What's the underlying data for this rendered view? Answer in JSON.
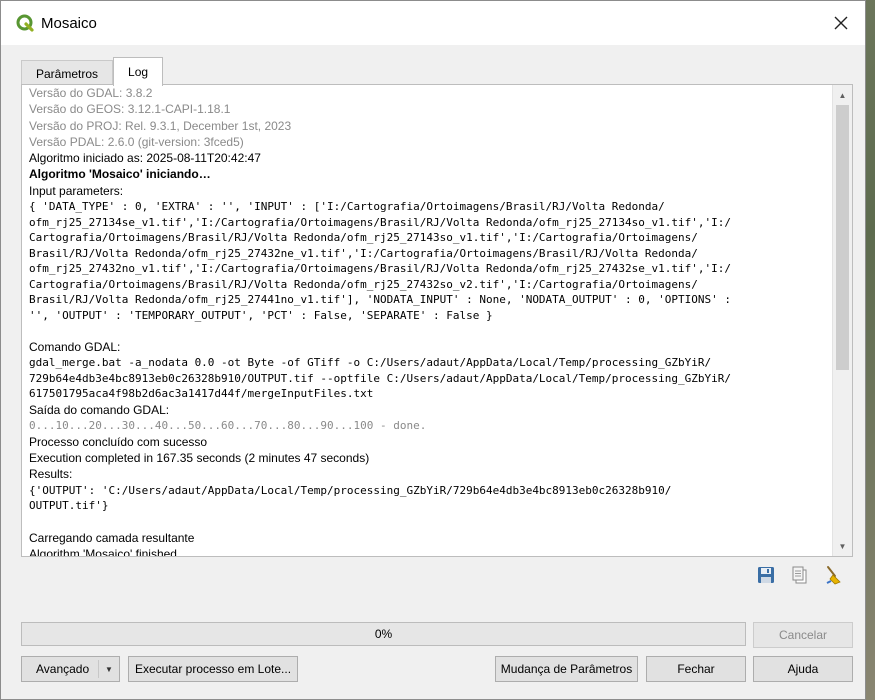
{
  "window": {
    "title": "Mosaico",
    "icon": "qgis-icon",
    "close_icon": "close-icon"
  },
  "tabs": [
    {
      "label": "Parâmetros",
      "active": false
    },
    {
      "label": "Log",
      "active": true
    }
  ],
  "log": {
    "lines": [
      {
        "text": "Versão do GDAL: 3.8.2",
        "style": "gray"
      },
      {
        "text": "Versão do GEOS: 3.12.1-CAPI-1.18.1",
        "style": "gray"
      },
      {
        "text": "Versão do PROJ: Rel. 9.3.1, December 1st, 2023",
        "style": "gray"
      },
      {
        "text": "Versão PDAL: 2.6.0 (git-version: 3fced5)",
        "style": "gray"
      },
      {
        "text": "Algoritmo iniciado as: 2025-08-11T20:42:47",
        "style": "normal"
      },
      {
        "text": "Algoritmo 'Mosaico' iniciando…",
        "style": "bold"
      },
      {
        "text": "Input parameters:",
        "style": "normal"
      },
      {
        "text": "{ 'DATA_TYPE' : 0, 'EXTRA' : '', 'INPUT' : ['I:/Cartografia/Ortoimagens/Brasil/RJ/Volta Redonda/",
        "style": "mono"
      },
      {
        "text": "ofm_rj25_27134se_v1.tif','I:/Cartografia/Ortoimagens/Brasil/RJ/Volta Redonda/ofm_rj25_27134so_v1.tif','I:/",
        "style": "mono"
      },
      {
        "text": "Cartografia/Ortoimagens/Brasil/RJ/Volta Redonda/ofm_rj25_27143so_v1.tif','I:/Cartografia/Ortoimagens/",
        "style": "mono"
      },
      {
        "text": "Brasil/RJ/Volta Redonda/ofm_rj25_27432ne_v1.tif','I:/Cartografia/Ortoimagens/Brasil/RJ/Volta Redonda/",
        "style": "mono"
      },
      {
        "text": "ofm_rj25_27432no_v1.tif','I:/Cartografia/Ortoimagens/Brasil/RJ/Volta Redonda/ofm_rj25_27432se_v1.tif','I:/",
        "style": "mono"
      },
      {
        "text": "Cartografia/Ortoimagens/Brasil/RJ/Volta Redonda/ofm_rj25_27432so_v2.tif','I:/Cartografia/Ortoimagens/",
        "style": "mono"
      },
      {
        "text": "Brasil/RJ/Volta Redonda/ofm_rj25_27441no_v1.tif'], 'NODATA_INPUT' : None, 'NODATA_OUTPUT' : 0, 'OPTIONS' :",
        "style": "mono"
      },
      {
        "text": "'', 'OUTPUT' : 'TEMPORARY_OUTPUT', 'PCT' : False, 'SEPARATE' : False }",
        "style": "mono"
      },
      {
        "text": "",
        "style": "blank"
      },
      {
        "text": "Comando GDAL:",
        "style": "normal"
      },
      {
        "text": "gdal_merge.bat -a_nodata 0.0 -ot Byte -of GTiff -o C:/Users/adaut/AppData/Local/Temp/processing_GZbYiR/",
        "style": "mono"
      },
      {
        "text": "729b64e4db3e4bc8913eb0c26328b910/OUTPUT.tif --optfile C:/Users/adaut/AppData/Local/Temp/processing_GZbYiR/",
        "style": "mono"
      },
      {
        "text": "617501795aca4f98b2d6ac3a1417d44f/mergeInputFiles.txt",
        "style": "mono"
      },
      {
        "text": "Saída do comando GDAL:",
        "style": "normal"
      },
      {
        "text": "0...10...20...30...40...50...60...70...80...90...100 - done.",
        "style": "mono gray"
      },
      {
        "text": "Processo concluído com sucesso",
        "style": "normal"
      },
      {
        "text": "Execution completed in 167.35 seconds (2 minutes 47 seconds)",
        "style": "normal"
      },
      {
        "text": "Results:",
        "style": "normal"
      },
      {
        "text": "{'OUTPUT': 'C:/Users/adaut/AppData/Local/Temp/processing_GZbYiR/729b64e4db3e4bc8913eb0c26328b910/",
        "style": "mono"
      },
      {
        "text": "OUTPUT.tif'}",
        "style": "mono"
      },
      {
        "text": "",
        "style": "blank"
      },
      {
        "text": "Carregando camada resultante",
        "style": "normal"
      },
      {
        "text": "Algorithm 'Mosaico' finished",
        "style": "normal"
      }
    ]
  },
  "log_tools": {
    "save_icon": "save-icon",
    "copy_icon": "copy-icon",
    "clear_icon": "clear-broom-icon"
  },
  "progress": {
    "value": 0,
    "label": "0%"
  },
  "buttons": {
    "advanced": "Avançado",
    "batch": "Executar processo em Lote...",
    "change_params": "Mudança de Parâmetros",
    "close": "Fechar",
    "help": "Ajuda",
    "cancel": "Cancelar"
  }
}
